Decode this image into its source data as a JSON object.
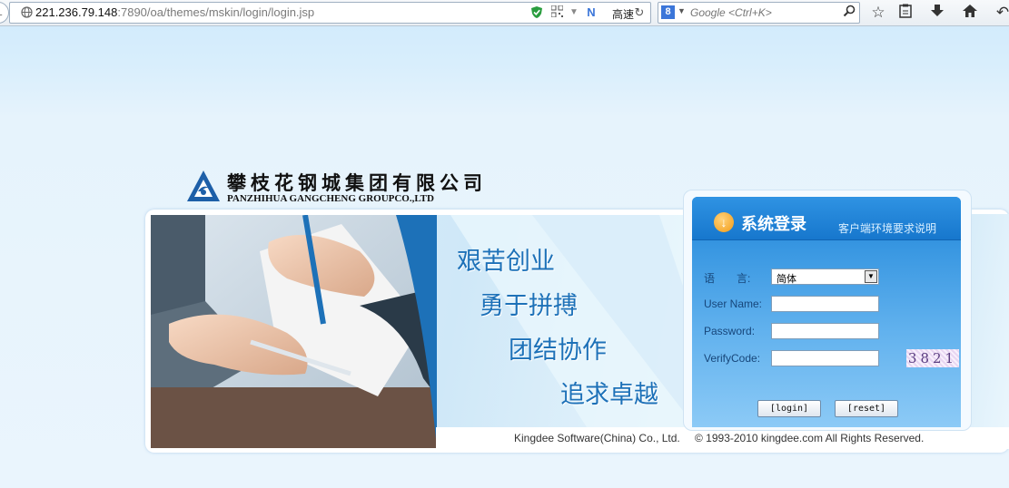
{
  "browser": {
    "url_host": "221.236.79.148",
    "url_path": ":7890/oa/themes/mskin/login/login.jsp",
    "speed_label": "高速",
    "search_placeholder": "Google <Ctrl+K>",
    "search_engine_badge": "8",
    "icons": [
      "back-icon",
      "globe-icon",
      "shield-icon",
      "qr-code-icon",
      "dropdown-icon",
      "speed-icon",
      "reload-icon",
      "search-icon",
      "star-icon",
      "clipboard-icon",
      "download-icon",
      "home-icon",
      "undo-icon"
    ]
  },
  "logo": {
    "name_cn": "攀枝花钢城集团有限公司",
    "name_en": "PANZHIHUA GANGCHENG GROUPCO.,LTD"
  },
  "banner": {
    "slogans": [
      "艰苦创业",
      "勇于拼搏",
      "团结协作",
      "追求卓越"
    ]
  },
  "login": {
    "title": "系统登录",
    "env_link": "客户端环境要求说明",
    "language_label": "语　　言:",
    "language_value": "简体",
    "username_label": "User Name:",
    "username_value": "",
    "password_label": "Password:",
    "password_value": "",
    "verify_label": "VerifyCode:",
    "verify_value": "",
    "captcha": "3821",
    "login_button": "[login]",
    "reset_button": "[reset]"
  },
  "footer": {
    "company": "Kingdee Software(China) Co., Ltd.",
    "copyright": "© 1993-2010 kingdee.com All Rights Reserved."
  },
  "colors": {
    "accent": "#1d71b8",
    "login_panel": "#1a82d8",
    "page_background": "#e6f3fc"
  }
}
